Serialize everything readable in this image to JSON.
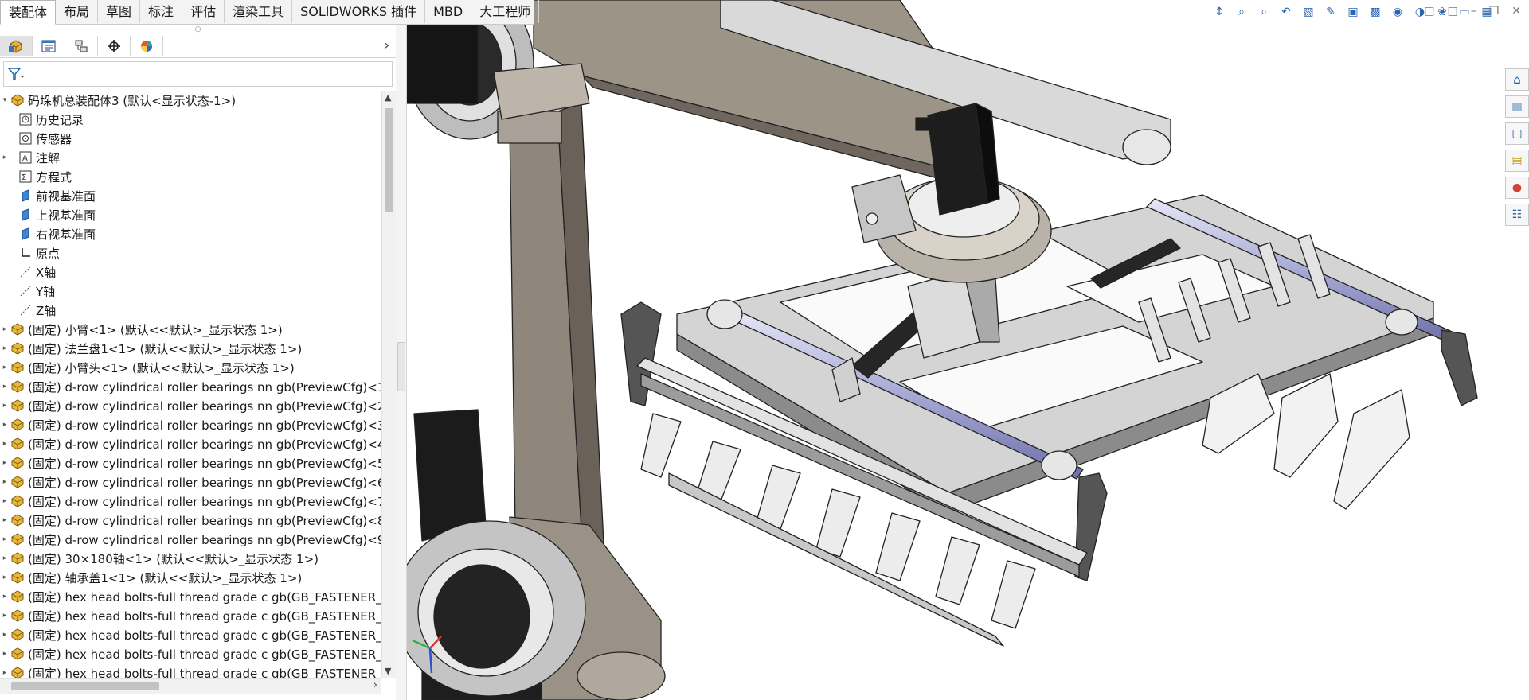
{
  "ribbon_tabs": [
    {
      "label": "装配体",
      "active": true
    },
    {
      "label": "布局"
    },
    {
      "label": "草图"
    },
    {
      "label": "标注"
    },
    {
      "label": "评估"
    },
    {
      "label": "渲染工具"
    },
    {
      "label": "SOLIDWORKS 插件"
    },
    {
      "label": "MBD"
    },
    {
      "label": "大工程师"
    }
  ],
  "panel_tabs": [
    "feature-manager-icon",
    "property-manager-icon",
    "configuration-manager-icon",
    "dimxpert-icon",
    "display-manager-icon"
  ],
  "tree": {
    "root": "码垛机总装配体3  (默认<显示状态-1>)",
    "items": [
      {
        "label": "历史记录",
        "icon": "history-icon",
        "exp": false
      },
      {
        "label": "传感器",
        "icon": "sensor-icon",
        "exp": false
      },
      {
        "label": "注解",
        "icon": "annotation-icon",
        "exp": true
      },
      {
        "label": "方程式",
        "icon": "equation-icon",
        "exp": false
      },
      {
        "label": "前视基准面",
        "icon": "plane-icon",
        "exp": false
      },
      {
        "label": "上视基准面",
        "icon": "plane-icon",
        "exp": false
      },
      {
        "label": "右视基准面",
        "icon": "plane-icon",
        "exp": false
      },
      {
        "label": "原点",
        "icon": "origin-icon",
        "exp": false
      },
      {
        "label": "X轴",
        "icon": "axis-icon",
        "exp": false
      },
      {
        "label": "Y轴",
        "icon": "axis-icon",
        "exp": false
      },
      {
        "label": "Z轴",
        "icon": "axis-icon",
        "exp": false
      },
      {
        "label": "(固定) 小臂<1> (默认<<默认>_显示状态 1>)",
        "icon": "part-icon",
        "exp": true
      },
      {
        "label": "(固定) 法兰盘1<1> (默认<<默认>_显示状态 1>)",
        "icon": "part-icon",
        "exp": true
      },
      {
        "label": "(固定) 小臂头<1> (默认<<默认>_显示状态 1>)",
        "icon": "part-icon",
        "exp": true
      },
      {
        "label": "(固定) d-row cylindrical roller bearings nn gb(PreviewCfg)<1",
        "icon": "part-icon",
        "exp": true
      },
      {
        "label": "(固定) d-row cylindrical roller bearings nn gb(PreviewCfg)<2",
        "icon": "part-icon",
        "exp": true
      },
      {
        "label": "(固定) d-row cylindrical roller bearings nn gb(PreviewCfg)<3",
        "icon": "part-icon",
        "exp": true
      },
      {
        "label": "(固定) d-row cylindrical roller bearings nn gb(PreviewCfg)<4",
        "icon": "part-icon",
        "exp": true
      },
      {
        "label": "(固定) d-row cylindrical roller bearings nn gb(PreviewCfg)<5",
        "icon": "part-icon",
        "exp": true
      },
      {
        "label": "(固定) d-row cylindrical roller bearings nn gb(PreviewCfg)<6",
        "icon": "part-icon",
        "exp": true
      },
      {
        "label": "(固定) d-row cylindrical roller bearings nn gb(PreviewCfg)<7",
        "icon": "part-icon",
        "exp": true
      },
      {
        "label": "(固定) d-row cylindrical roller bearings nn gb(PreviewCfg)<8",
        "icon": "part-icon",
        "exp": true
      },
      {
        "label": "(固定) d-row cylindrical roller bearings nn gb(PreviewCfg)<9",
        "icon": "part-icon",
        "exp": true
      },
      {
        "label": "(固定) 30×180轴<1> (默认<<默认>_显示状态 1>)",
        "icon": "part-icon",
        "exp": true
      },
      {
        "label": "(固定) 轴承盖1<1> (默认<<默认>_显示状态 1>)",
        "icon": "part-icon",
        "exp": true
      },
      {
        "label": "(固定) hex head bolts-full thread grade c gb(GB_FASTENER_",
        "icon": "part-icon",
        "exp": true
      },
      {
        "label": "(固定) hex head bolts-full thread grade c gb(GB_FASTENER_",
        "icon": "part-icon",
        "exp": true
      },
      {
        "label": "(固定) hex head bolts-full thread grade c gb(GB_FASTENER_",
        "icon": "part-icon",
        "exp": true
      },
      {
        "label": "(固定) hex head bolts-full thread grade c gb(GB_FASTENER_",
        "icon": "part-icon",
        "exp": true
      },
      {
        "label": "(固定) hex head bolts-full thread grade c gb(GB_FASTENER_",
        "icon": "part-icon",
        "exp": true
      }
    ]
  },
  "triad": {
    "x": "X",
    "y": "Y",
    "z": "Z"
  }
}
